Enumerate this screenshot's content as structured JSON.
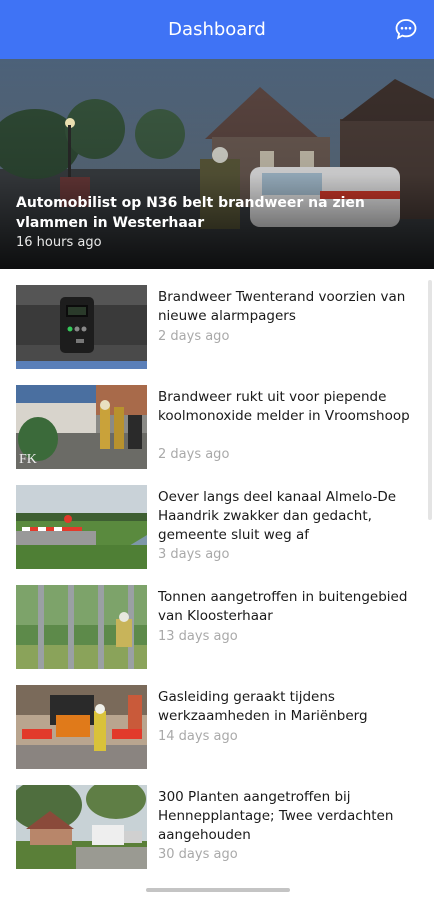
{
  "appbar": {
    "title": "Dashboard",
    "chat_icon": "chat-bubble-icon"
  },
  "hero": {
    "title": "Automobilist op N36 belt brandweer na zien vlammen in Westerhaar",
    "time": "16 hours ago"
  },
  "articles": [
    {
      "title": "Brandweer Twenterand voorzien van nieuwe alarmpagers",
      "time": "2 days ago"
    },
    {
      "title": "Brandweer rukt uit voor piepende koolmonoxide melder in Vroomshoop",
      "time": "2 days ago"
    },
    {
      "title": "Oever langs deel kanaal Almelo-De Haandrik zwakker dan gedacht, gemeente sluit weg af",
      "time": "3 days ago"
    },
    {
      "title": "Tonnen aangetroffen in buitengebied van Kloosterhaar",
      "time": "13 days ago"
    },
    {
      "title": "Gasleiding geraakt tijdens werkzaamheden in Mariënberg",
      "time": "14 days ago"
    },
    {
      "title": "300 Planten aangetroffen bij Hennepplantage; Twee verdachten aangehouden",
      "time": "30 days ago"
    }
  ],
  "colors": {
    "appbar": "#3f73f5",
    "time_text": "#a9a9a9"
  }
}
